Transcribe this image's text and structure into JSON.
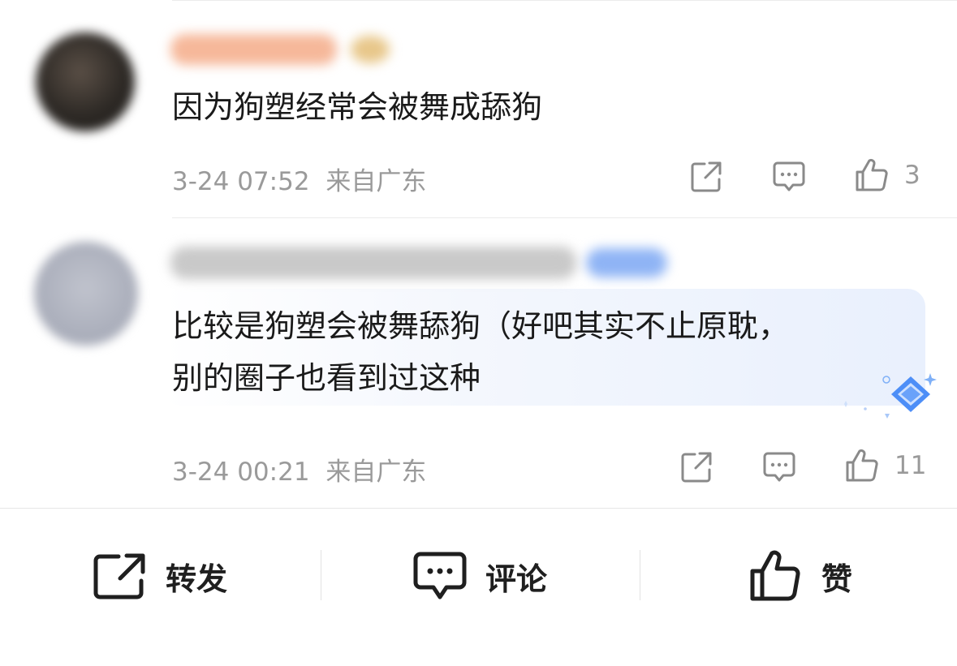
{
  "comments": [
    {
      "text": "因为狗塑经常会被舞成舔狗",
      "time": "3-24 07:52",
      "location": "来自广东",
      "likes": "3",
      "highlighted": false
    },
    {
      "text_line1": "比较是狗塑会被舞舔狗（好吧其实不止原耽，",
      "text_line2": "别的圈子也看到过这种",
      "time": "3-24 00:21",
      "location": "来自广东",
      "likes": "11",
      "highlighted": true
    }
  ],
  "bottom_bar": {
    "repost_label": "转发",
    "comment_label": "评论",
    "like_label": "赞"
  },
  "colors": {
    "meta_gray": "#9a9a9a",
    "icon_gray": "#8a8a8a",
    "highlight_blue": "#e9f0fd",
    "badge_blue": "#4d8ef7"
  }
}
